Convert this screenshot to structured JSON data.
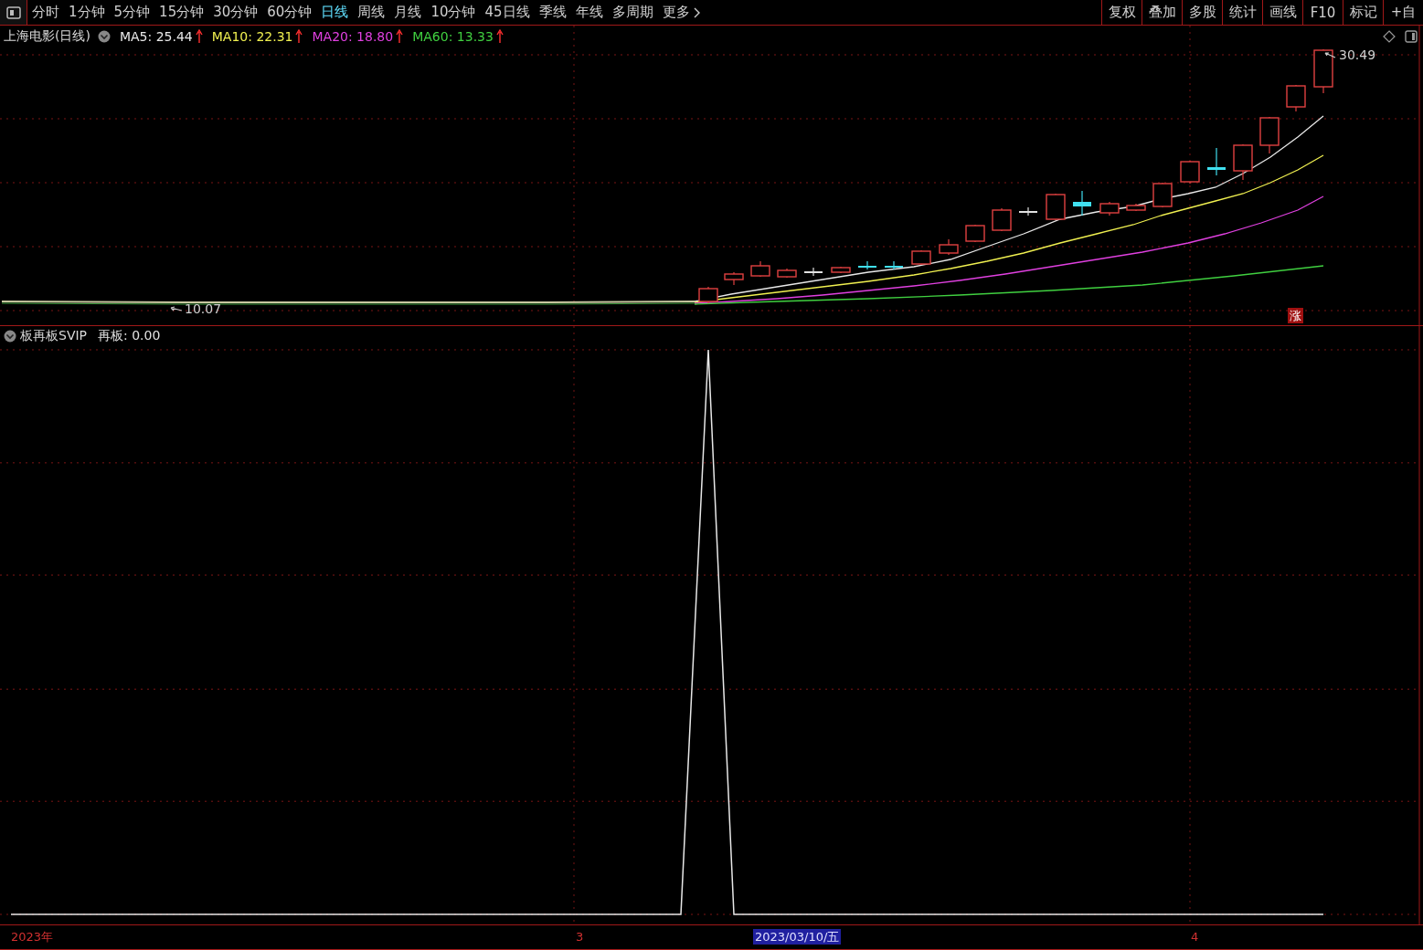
{
  "toolbar": {
    "tabs": [
      {
        "label": "分时",
        "selected": false
      },
      {
        "label": "1分钟",
        "selected": false
      },
      {
        "label": "5分钟",
        "selected": false
      },
      {
        "label": "15分钟",
        "selected": false
      },
      {
        "label": "30分钟",
        "selected": false
      },
      {
        "label": "60分钟",
        "selected": false
      },
      {
        "label": "日线",
        "selected": true
      },
      {
        "label": "周线",
        "selected": false
      },
      {
        "label": "月线",
        "selected": false
      },
      {
        "label": "10分钟",
        "selected": false
      },
      {
        "label": "45日线",
        "selected": false
      },
      {
        "label": "季线",
        "selected": false
      },
      {
        "label": "年线",
        "selected": false
      },
      {
        "label": "多周期",
        "selected": false
      }
    ],
    "more": "更多",
    "buttons": [
      "复权",
      "叠加",
      "多股",
      "统计",
      "画线",
      "F10",
      "标记",
      "+自"
    ]
  },
  "main_chart": {
    "title": "上海电影(日线)",
    "moving_averages": [
      {
        "label": "MA5: 25.44",
        "color": "#e8e8e8"
      },
      {
        "label": "MA10: 22.31",
        "color": "#f0f050"
      },
      {
        "label": "MA20: 18.80",
        "color": "#e040e0"
      },
      {
        "label": "MA60: 13.33",
        "color": "#40d040"
      }
    ],
    "high_label": "30.49",
    "low_label": "10.07",
    "badge": "涨"
  },
  "indicator": {
    "name": "板再板SVIP",
    "reading": "再板: 0.00"
  },
  "time_axis": {
    "labels": [
      {
        "text": "2023年",
        "selected": false
      },
      {
        "text": "3",
        "selected": false
      },
      {
        "text": "2023/03/10/五",
        "selected": true
      },
      {
        "text": "4",
        "selected": false
      }
    ]
  }
}
